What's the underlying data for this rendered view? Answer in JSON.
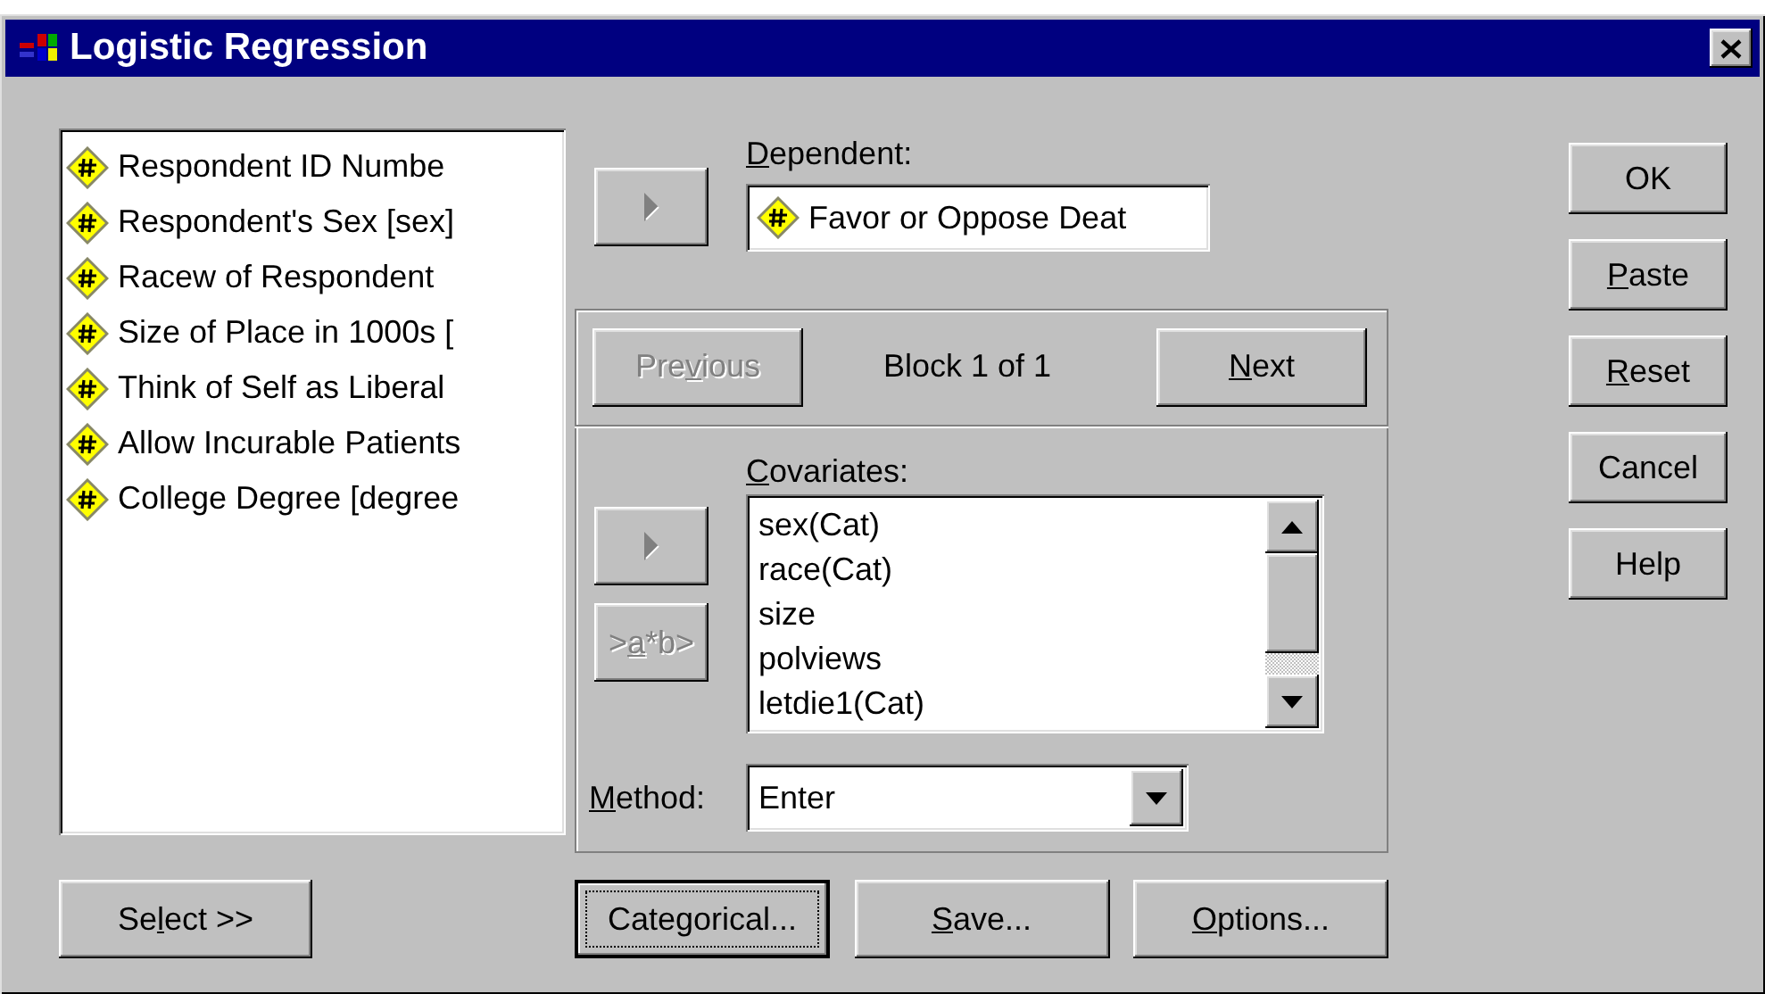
{
  "window": {
    "title": "Logistic Regression"
  },
  "variables": [
    {
      "label": "Respondent ID Numbe"
    },
    {
      "label": "Respondent's Sex [sex]"
    },
    {
      "label": "Racew of Respondent"
    },
    {
      "label": "Size of Place in 1000s ["
    },
    {
      "label": "Think of Self as Liberal"
    },
    {
      "label": "Allow Incurable Patients"
    },
    {
      "label": "College Degree [degree"
    }
  ],
  "select_button": {
    "label": {
      "before": "Se",
      "key": "l",
      "after": "ect >>"
    }
  },
  "dependent": {
    "move_disabled": true,
    "label": {
      "key": "D",
      "after": "ependent:"
    },
    "value": "Favor or Oppose Deat"
  },
  "block": {
    "previous": {
      "label": {
        "before": "Pre",
        "key": "v",
        "after": "ious"
      },
      "disabled": true
    },
    "caption": "Block 1 of 1",
    "next": {
      "label": {
        "key": "N",
        "after": "ext"
      },
      "disabled": false
    }
  },
  "covariates": {
    "label": {
      "key": "C",
      "after": "ovariates:"
    },
    "move_disabled": true,
    "interaction": {
      "label": {
        "before": ">",
        "key": "a",
        "after": "*b>"
      },
      "disabled": true
    },
    "items": [
      "sex(Cat)",
      "race(Cat)",
      "size",
      "polviews",
      "letdie1(Cat)"
    ]
  },
  "method": {
    "label": {
      "key": "M",
      "after": "ethod:"
    },
    "value": "Enter"
  },
  "bottom_buttons": [
    {
      "label": {
        "text": "Categorical..."
      },
      "focused": true
    },
    {
      "label": {
        "key": "S",
        "after": "ave..."
      },
      "focused": false
    },
    {
      "label": {
        "key": "O",
        "after": "ptions..."
      },
      "focused": false
    }
  ],
  "side_buttons": [
    {
      "label": {
        "text": "OK"
      }
    },
    {
      "label": {
        "key": "P",
        "after": "aste"
      }
    },
    {
      "label": {
        "key": "R",
        "after": "eset"
      }
    },
    {
      "label": {
        "text": "Cancel"
      }
    },
    {
      "label": {
        "text": "Help"
      }
    }
  ]
}
